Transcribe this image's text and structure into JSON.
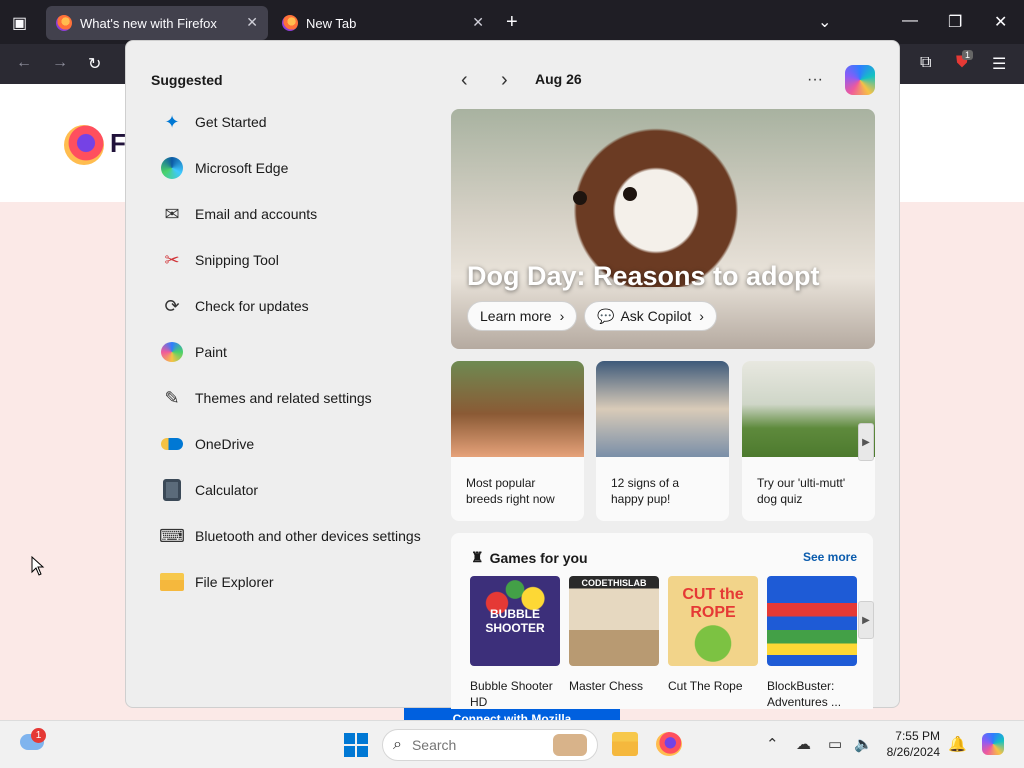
{
  "browser": {
    "tabs": [
      {
        "title": "What's new with Firefox",
        "active": true
      },
      {
        "title": "New Tab",
        "active": false
      }
    ],
    "new_tab_symbol": "+",
    "extension_badge": "1"
  },
  "start_menu": {
    "suggested_title": "Suggested",
    "suggested": [
      {
        "label": "Get Started",
        "icon": "get-started-icon"
      },
      {
        "label": "Microsoft Edge",
        "icon": "edge-icon"
      },
      {
        "label": "Email and accounts",
        "icon": "mail-icon"
      },
      {
        "label": "Snipping Tool",
        "icon": "snipping-tool-icon"
      },
      {
        "label": "Check for updates",
        "icon": "update-icon"
      },
      {
        "label": "Paint",
        "icon": "paint-icon"
      },
      {
        "label": "Themes and related settings",
        "icon": "brush-icon"
      },
      {
        "label": "OneDrive",
        "icon": "onedrive-icon"
      },
      {
        "label": "Calculator",
        "icon": "calculator-icon"
      },
      {
        "label": "Bluetooth and other devices settings",
        "icon": "devices-icon"
      },
      {
        "label": "File Explorer",
        "icon": "folder-icon"
      }
    ]
  },
  "widgets": {
    "date": "Aug 26",
    "more_symbol": "···",
    "hero": {
      "title": "Dog Day: Reasons to adopt",
      "learn_more": "Learn more",
      "ask_copilot": "Ask Copilot"
    },
    "cards": [
      {
        "text": "Most popular breeds right now"
      },
      {
        "text": "12 signs of a happy pup!"
      },
      {
        "text": "Try our 'ulti-mutt' dog quiz"
      }
    ],
    "games": {
      "title": "Games for you",
      "see_more": "See more",
      "items": [
        {
          "name": "Bubble Shooter HD",
          "thumb_text": "BUBBLE SHOOTER"
        },
        {
          "name": "Master Chess",
          "thumb_text": "CODETHISLAB"
        },
        {
          "name": "Cut The Rope",
          "thumb_text": "CUT the ROPE"
        },
        {
          "name": "BlockBuster: Adventures ...",
          "thumb_text": ""
        }
      ]
    }
  },
  "taskbar": {
    "weather_badge": "1",
    "search_placeholder": "Search",
    "time": "7:55 PM",
    "date": "8/26/2024"
  },
  "page": {
    "logo_letter": "F",
    "cta_label": "Connect with Mozilla"
  },
  "colors": {
    "accent": "#0078d4",
    "link": "#0b5cad",
    "tabbar": "#1f1e25",
    "page_pink": "#fbe9e7"
  }
}
